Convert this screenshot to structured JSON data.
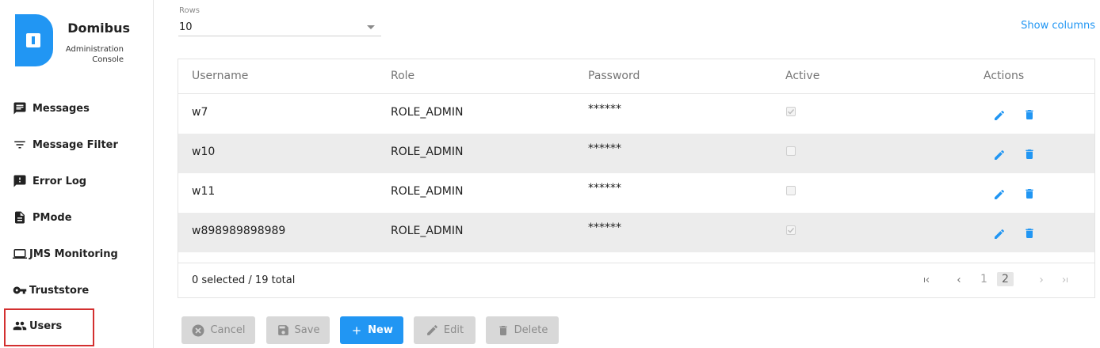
{
  "brand": {
    "title": "Domibus",
    "subtitle_line1": "Administration",
    "subtitle_line2": "Console",
    "color": "#2196f3"
  },
  "sidebar": {
    "items": [
      {
        "label": "Messages",
        "icon": "messages-icon"
      },
      {
        "label": "Message Filter",
        "icon": "filter-icon"
      },
      {
        "label": "Error Log",
        "icon": "error-log-icon"
      },
      {
        "label": "PMode",
        "icon": "document-icon"
      },
      {
        "label": "JMS Monitoring",
        "icon": "laptop-icon"
      },
      {
        "label": "Truststore",
        "icon": "key-icon"
      },
      {
        "label": "Users",
        "icon": "users-icon",
        "highlighted": true
      }
    ]
  },
  "rows": {
    "label": "Rows",
    "value": "10"
  },
  "show_columns": "Show columns",
  "table": {
    "headers": [
      "Username",
      "Role",
      "Password",
      "Active",
      "Actions"
    ],
    "rows": [
      {
        "username": "w7",
        "role": "ROLE_ADMIN",
        "password": "******",
        "active": true
      },
      {
        "username": "w10",
        "role": "ROLE_ADMIN",
        "password": "******",
        "active": false
      },
      {
        "username": "w11",
        "role": "ROLE_ADMIN",
        "password": "******",
        "active": false
      },
      {
        "username": "w898989898989",
        "role": "ROLE_ADMIN",
        "password": "******",
        "active": true
      }
    ],
    "selection_summary": "0 selected / 19 total",
    "pagination": {
      "pages": [
        "1",
        "2"
      ],
      "current": "2"
    }
  },
  "buttons": {
    "cancel": "Cancel",
    "save": "Save",
    "new": "New",
    "edit": "Edit",
    "delete": "Delete"
  },
  "colors": {
    "accent": "#2196f3",
    "highlight_border": "#d32f2f",
    "row_alt": "#ececec"
  }
}
